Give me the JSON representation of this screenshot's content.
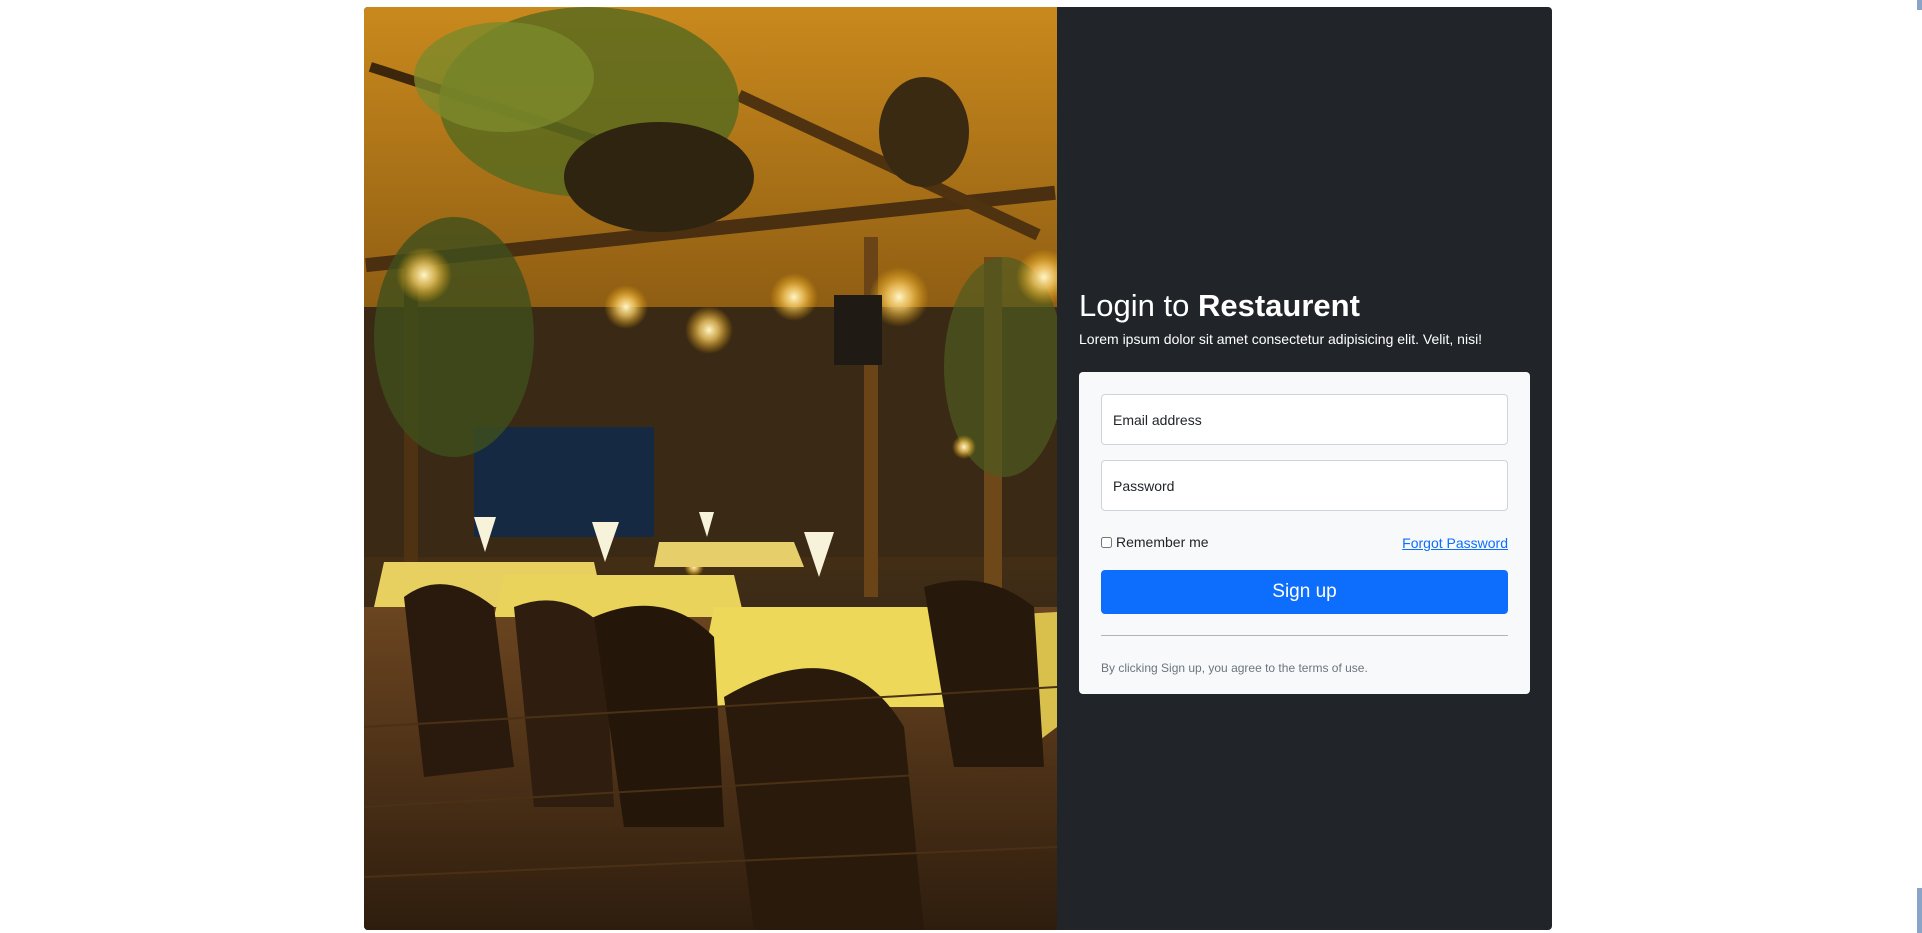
{
  "login": {
    "title_prefix": "Login to",
    "title_brand": "Restaurent",
    "subtitle": "Lorem ipsum dolor sit amet consectetur adipisicing elit. Velit, nisi!",
    "email_placeholder": "Email address",
    "password_placeholder": "Password",
    "remember_label": "Remember me",
    "forgot_label": "Forgot Password",
    "submit_label": "Sign up",
    "terms_text": "By clicking Sign up, you agree to the terms of use."
  },
  "colors": {
    "panel_bg": "#212529",
    "form_bg": "#f8f9fa",
    "primary": "#0d6efd",
    "muted_text": "#6c757d"
  },
  "image": {
    "subject": "restaurant-interior-photo"
  }
}
